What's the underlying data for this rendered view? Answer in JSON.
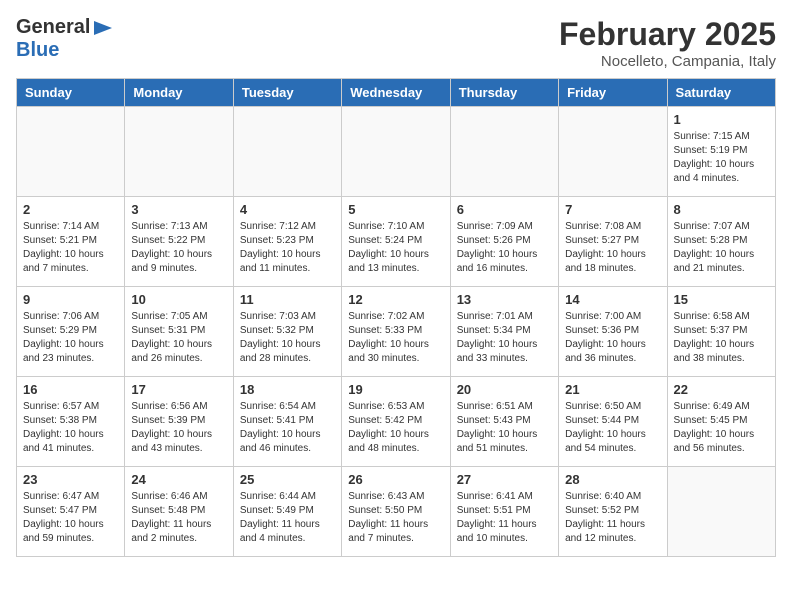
{
  "logo": {
    "general": "General",
    "blue": "Blue"
  },
  "header": {
    "month": "February 2025",
    "location": "Nocelleto, Campania, Italy"
  },
  "weekdays": [
    "Sunday",
    "Monday",
    "Tuesday",
    "Wednesday",
    "Thursday",
    "Friday",
    "Saturday"
  ],
  "weeks": [
    [
      {
        "day": "",
        "info": ""
      },
      {
        "day": "",
        "info": ""
      },
      {
        "day": "",
        "info": ""
      },
      {
        "day": "",
        "info": ""
      },
      {
        "day": "",
        "info": ""
      },
      {
        "day": "",
        "info": ""
      },
      {
        "day": "1",
        "info": "Sunrise: 7:15 AM\nSunset: 5:19 PM\nDaylight: 10 hours and 4 minutes."
      }
    ],
    [
      {
        "day": "2",
        "info": "Sunrise: 7:14 AM\nSunset: 5:21 PM\nDaylight: 10 hours and 7 minutes."
      },
      {
        "day": "3",
        "info": "Sunrise: 7:13 AM\nSunset: 5:22 PM\nDaylight: 10 hours and 9 minutes."
      },
      {
        "day": "4",
        "info": "Sunrise: 7:12 AM\nSunset: 5:23 PM\nDaylight: 10 hours and 11 minutes."
      },
      {
        "day": "5",
        "info": "Sunrise: 7:10 AM\nSunset: 5:24 PM\nDaylight: 10 hours and 13 minutes."
      },
      {
        "day": "6",
        "info": "Sunrise: 7:09 AM\nSunset: 5:26 PM\nDaylight: 10 hours and 16 minutes."
      },
      {
        "day": "7",
        "info": "Sunrise: 7:08 AM\nSunset: 5:27 PM\nDaylight: 10 hours and 18 minutes."
      },
      {
        "day": "8",
        "info": "Sunrise: 7:07 AM\nSunset: 5:28 PM\nDaylight: 10 hours and 21 minutes."
      }
    ],
    [
      {
        "day": "9",
        "info": "Sunrise: 7:06 AM\nSunset: 5:29 PM\nDaylight: 10 hours and 23 minutes."
      },
      {
        "day": "10",
        "info": "Sunrise: 7:05 AM\nSunset: 5:31 PM\nDaylight: 10 hours and 26 minutes."
      },
      {
        "day": "11",
        "info": "Sunrise: 7:03 AM\nSunset: 5:32 PM\nDaylight: 10 hours and 28 minutes."
      },
      {
        "day": "12",
        "info": "Sunrise: 7:02 AM\nSunset: 5:33 PM\nDaylight: 10 hours and 30 minutes."
      },
      {
        "day": "13",
        "info": "Sunrise: 7:01 AM\nSunset: 5:34 PM\nDaylight: 10 hours and 33 minutes."
      },
      {
        "day": "14",
        "info": "Sunrise: 7:00 AM\nSunset: 5:36 PM\nDaylight: 10 hours and 36 minutes."
      },
      {
        "day": "15",
        "info": "Sunrise: 6:58 AM\nSunset: 5:37 PM\nDaylight: 10 hours and 38 minutes."
      }
    ],
    [
      {
        "day": "16",
        "info": "Sunrise: 6:57 AM\nSunset: 5:38 PM\nDaylight: 10 hours and 41 minutes."
      },
      {
        "day": "17",
        "info": "Sunrise: 6:56 AM\nSunset: 5:39 PM\nDaylight: 10 hours and 43 minutes."
      },
      {
        "day": "18",
        "info": "Sunrise: 6:54 AM\nSunset: 5:41 PM\nDaylight: 10 hours and 46 minutes."
      },
      {
        "day": "19",
        "info": "Sunrise: 6:53 AM\nSunset: 5:42 PM\nDaylight: 10 hours and 48 minutes."
      },
      {
        "day": "20",
        "info": "Sunrise: 6:51 AM\nSunset: 5:43 PM\nDaylight: 10 hours and 51 minutes."
      },
      {
        "day": "21",
        "info": "Sunrise: 6:50 AM\nSunset: 5:44 PM\nDaylight: 10 hours and 54 minutes."
      },
      {
        "day": "22",
        "info": "Sunrise: 6:49 AM\nSunset: 5:45 PM\nDaylight: 10 hours and 56 minutes."
      }
    ],
    [
      {
        "day": "23",
        "info": "Sunrise: 6:47 AM\nSunset: 5:47 PM\nDaylight: 10 hours and 59 minutes."
      },
      {
        "day": "24",
        "info": "Sunrise: 6:46 AM\nSunset: 5:48 PM\nDaylight: 11 hours and 2 minutes."
      },
      {
        "day": "25",
        "info": "Sunrise: 6:44 AM\nSunset: 5:49 PM\nDaylight: 11 hours and 4 minutes."
      },
      {
        "day": "26",
        "info": "Sunrise: 6:43 AM\nSunset: 5:50 PM\nDaylight: 11 hours and 7 minutes."
      },
      {
        "day": "27",
        "info": "Sunrise: 6:41 AM\nSunset: 5:51 PM\nDaylight: 11 hours and 10 minutes."
      },
      {
        "day": "28",
        "info": "Sunrise: 6:40 AM\nSunset: 5:52 PM\nDaylight: 11 hours and 12 minutes."
      },
      {
        "day": "",
        "info": ""
      }
    ]
  ]
}
